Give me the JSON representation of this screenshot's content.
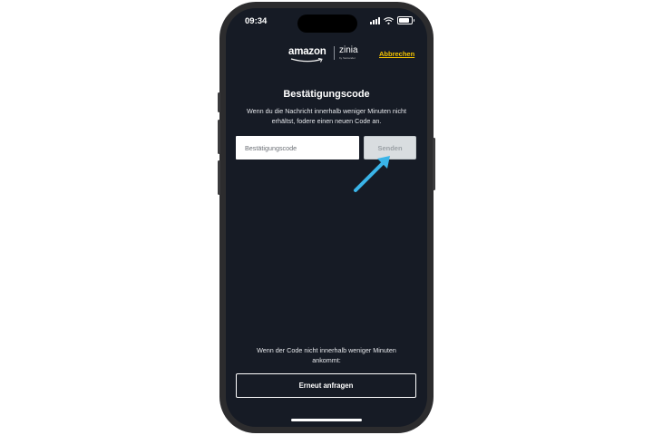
{
  "status_bar": {
    "time": "09:34"
  },
  "header": {
    "amazon_logo": "amazon",
    "zinia_logo": "zinia",
    "zinia_subtext": "by Santander",
    "cancel_label": "Abbrechen"
  },
  "verification": {
    "title": "Bestätigungscode",
    "instructions": "Wenn du die Nachricht innerhalb weniger Minuten nicht erhältst, fodere einen neuen Code an.",
    "code_placeholder": "Bestätigungscode",
    "code_value": "",
    "send_label": "Senden"
  },
  "resend": {
    "note": "Wenn der Code nicht innerhalb weniger Minuten ankommt:",
    "button_label": "Erneut anfragen"
  },
  "colors": {
    "background": "#161b25",
    "accent_link": "#f2c200",
    "annotation_arrow": "#3ab4e8",
    "disabled_button": "#d9dde0"
  },
  "icons": [
    "signal-icon",
    "wifi-icon",
    "battery-icon",
    "annotation-arrow-icon"
  ]
}
